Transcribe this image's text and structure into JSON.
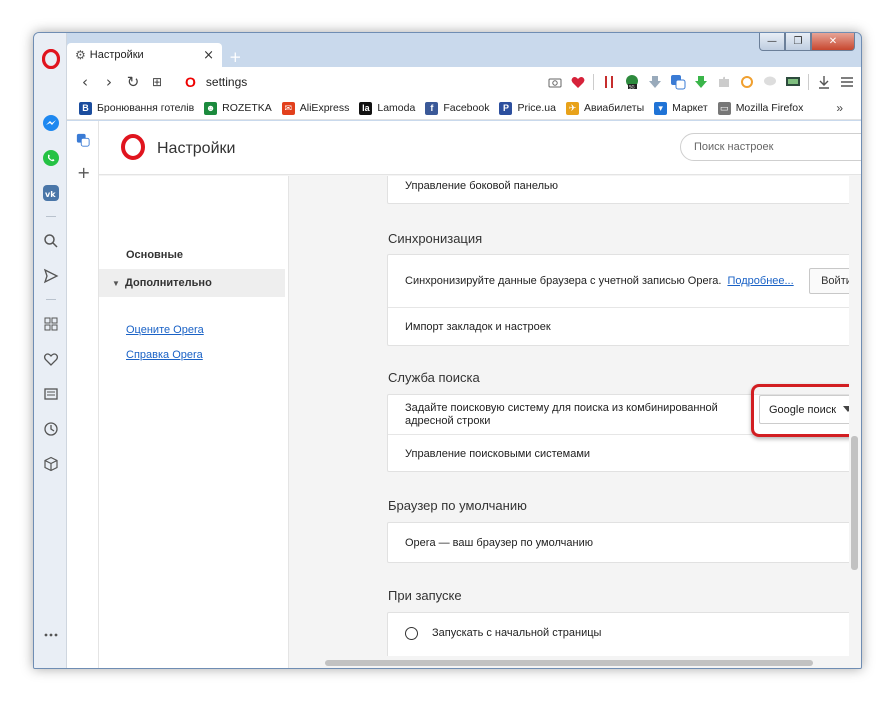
{
  "window": {
    "menu_glyph": "⌄",
    "min": "—",
    "max": "❐",
    "close": "✕"
  },
  "tab": {
    "title": "Настройки",
    "close": "×",
    "new_tab": "+"
  },
  "toolbar": {
    "address": "settings"
  },
  "bookmarks": [
    {
      "label": "Бронювання готелів",
      "icon_text": "B",
      "color": "#1b4d9e"
    },
    {
      "label": "ROZETKA",
      "icon_text": "☻",
      "color": "#1b8a3d"
    },
    {
      "label": "AliExpress",
      "icon_text": "✉",
      "color": "#e2401c"
    },
    {
      "label": "Lamoda",
      "icon_text": "la",
      "color": "#111111"
    },
    {
      "label": "Facebook",
      "icon_text": "f",
      "color": "#3b5998"
    },
    {
      "label": "Price.ua",
      "icon_text": "P",
      "color": "#2c4f9e"
    },
    {
      "label": "Авиабилеты",
      "icon_text": "✈",
      "color": "#e8a21a"
    },
    {
      "label": "Маркет",
      "icon_text": "▾",
      "color": "#1f73d6"
    },
    {
      "label": "Mozilla Firefox",
      "icon_text": "▭",
      "color": "#777777"
    }
  ],
  "bookmarks_more": "»",
  "settings": {
    "title": "Настройки",
    "search_placeholder": "Поиск настроек",
    "nav": {
      "basic": "Основные",
      "advanced": "Дополнительно",
      "rate": "Оцените Opera",
      "help": "Справка Opera"
    },
    "sidebar_row": "Управление боковой панелью",
    "sync": {
      "title": "Синхронизация",
      "text": "Синхронизируйте данные браузера с учетной записью Opera.",
      "link": "Подробнее...",
      "button": "Войти",
      "import": "Импорт закладок и настроек"
    },
    "search_service": {
      "title": "Служба поиска",
      "text": "Задайте поисковую систему для поиска из комбинированной адресной строки",
      "selected": "Google поиск",
      "manage": "Управление поисковыми системами"
    },
    "default_browser": {
      "title": "Браузер по умолчанию",
      "text": "Opera — ваш браузер по умолчанию"
    },
    "startup": {
      "title": "При запуске",
      "option": "Запускать с начальной страницы"
    }
  }
}
